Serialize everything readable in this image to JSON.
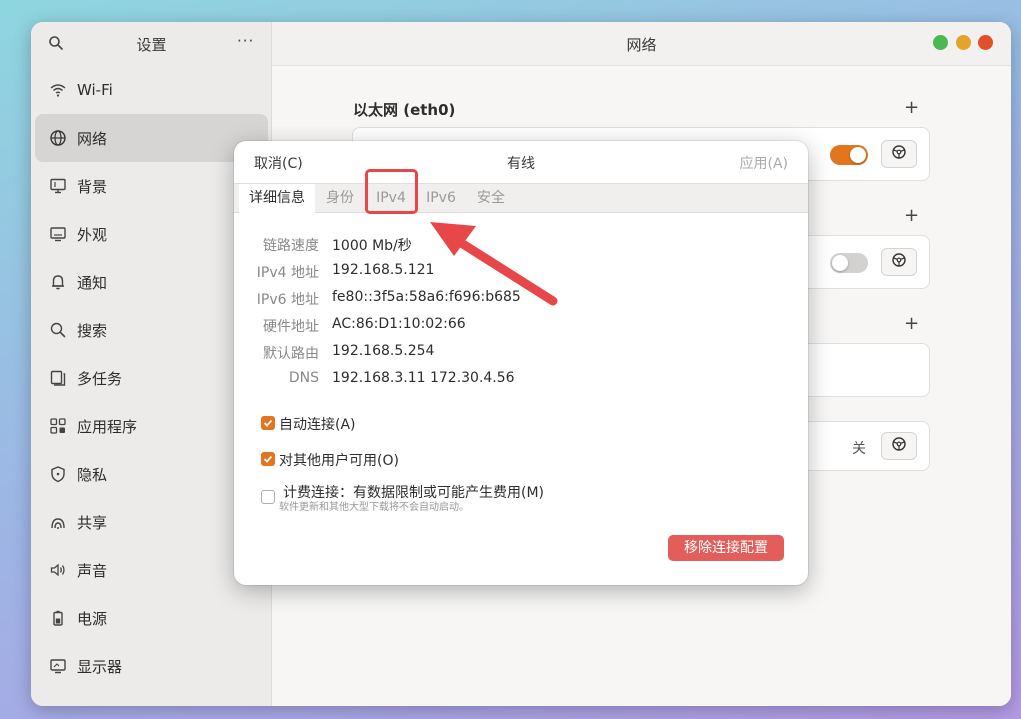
{
  "sidebar": {
    "title": "设置",
    "more": "···",
    "items": [
      {
        "label": "Wi-Fi",
        "icon": "wifi-icon"
      },
      {
        "label": "网络",
        "icon": "globe-icon",
        "active": true
      },
      {
        "label": "背景",
        "icon": "monitor-wallpaper-icon"
      },
      {
        "label": "外观",
        "icon": "display-appearance-icon"
      },
      {
        "label": "通知",
        "icon": "bell-icon"
      },
      {
        "label": "搜索",
        "icon": "search-icon"
      },
      {
        "label": "多任务",
        "icon": "multitasking-icon"
      },
      {
        "label": "应用程序",
        "icon": "apps-grid-icon"
      },
      {
        "label": "隐私",
        "icon": "shield-icon"
      },
      {
        "label": "共享",
        "icon": "share-icon"
      },
      {
        "label": "声音",
        "icon": "speaker-icon"
      },
      {
        "label": "电源",
        "icon": "battery-icon"
      },
      {
        "label": "显示器",
        "icon": "display-icon"
      }
    ]
  },
  "main": {
    "title": "网络",
    "section_ethernet": "以太网 (eth0)",
    "ethernet_toggle_on": true,
    "second_toggle_on": false,
    "off_label": "关"
  },
  "dialog": {
    "cancel": "取消(C)",
    "title": "有线",
    "apply": "应用(A)",
    "tabs": [
      "详细信息",
      "身份",
      "IPv4",
      "IPv6",
      "安全"
    ],
    "active_tab": 0,
    "details": [
      {
        "key": "链路速度",
        "value": "1000 Mb/秒"
      },
      {
        "key": "IPv4 地址",
        "value": "192.168.5.121"
      },
      {
        "key": "IPv6 地址",
        "value": "fe80::3f5a:58a6:f696:b685"
      },
      {
        "key": "硬件地址",
        "value": "AC:86:D1:10:02:66"
      },
      {
        "key": "默认路由",
        "value": "192.168.5.254"
      },
      {
        "key": "DNS",
        "value": "192.168.3.11 172.30.4.56"
      }
    ],
    "auto_connect": {
      "label": "自动连接(A)",
      "checked": true
    },
    "all_users": {
      "label": "对其他用户可用(O)",
      "checked": true
    },
    "metered": {
      "label": "计费连接：有数据限制或可能产生费用(M)",
      "checked": false,
      "hint": "软件更新和其他大型下载将不会自动启动。"
    },
    "remove_button": "移除连接配置"
  },
  "colors": {
    "accent": "#e2761f",
    "destructive": "#e35d5b",
    "annotation": "#e8474a",
    "close": "#e0502a",
    "minimize": "#e2a52a",
    "maximize": "#4bb852"
  }
}
